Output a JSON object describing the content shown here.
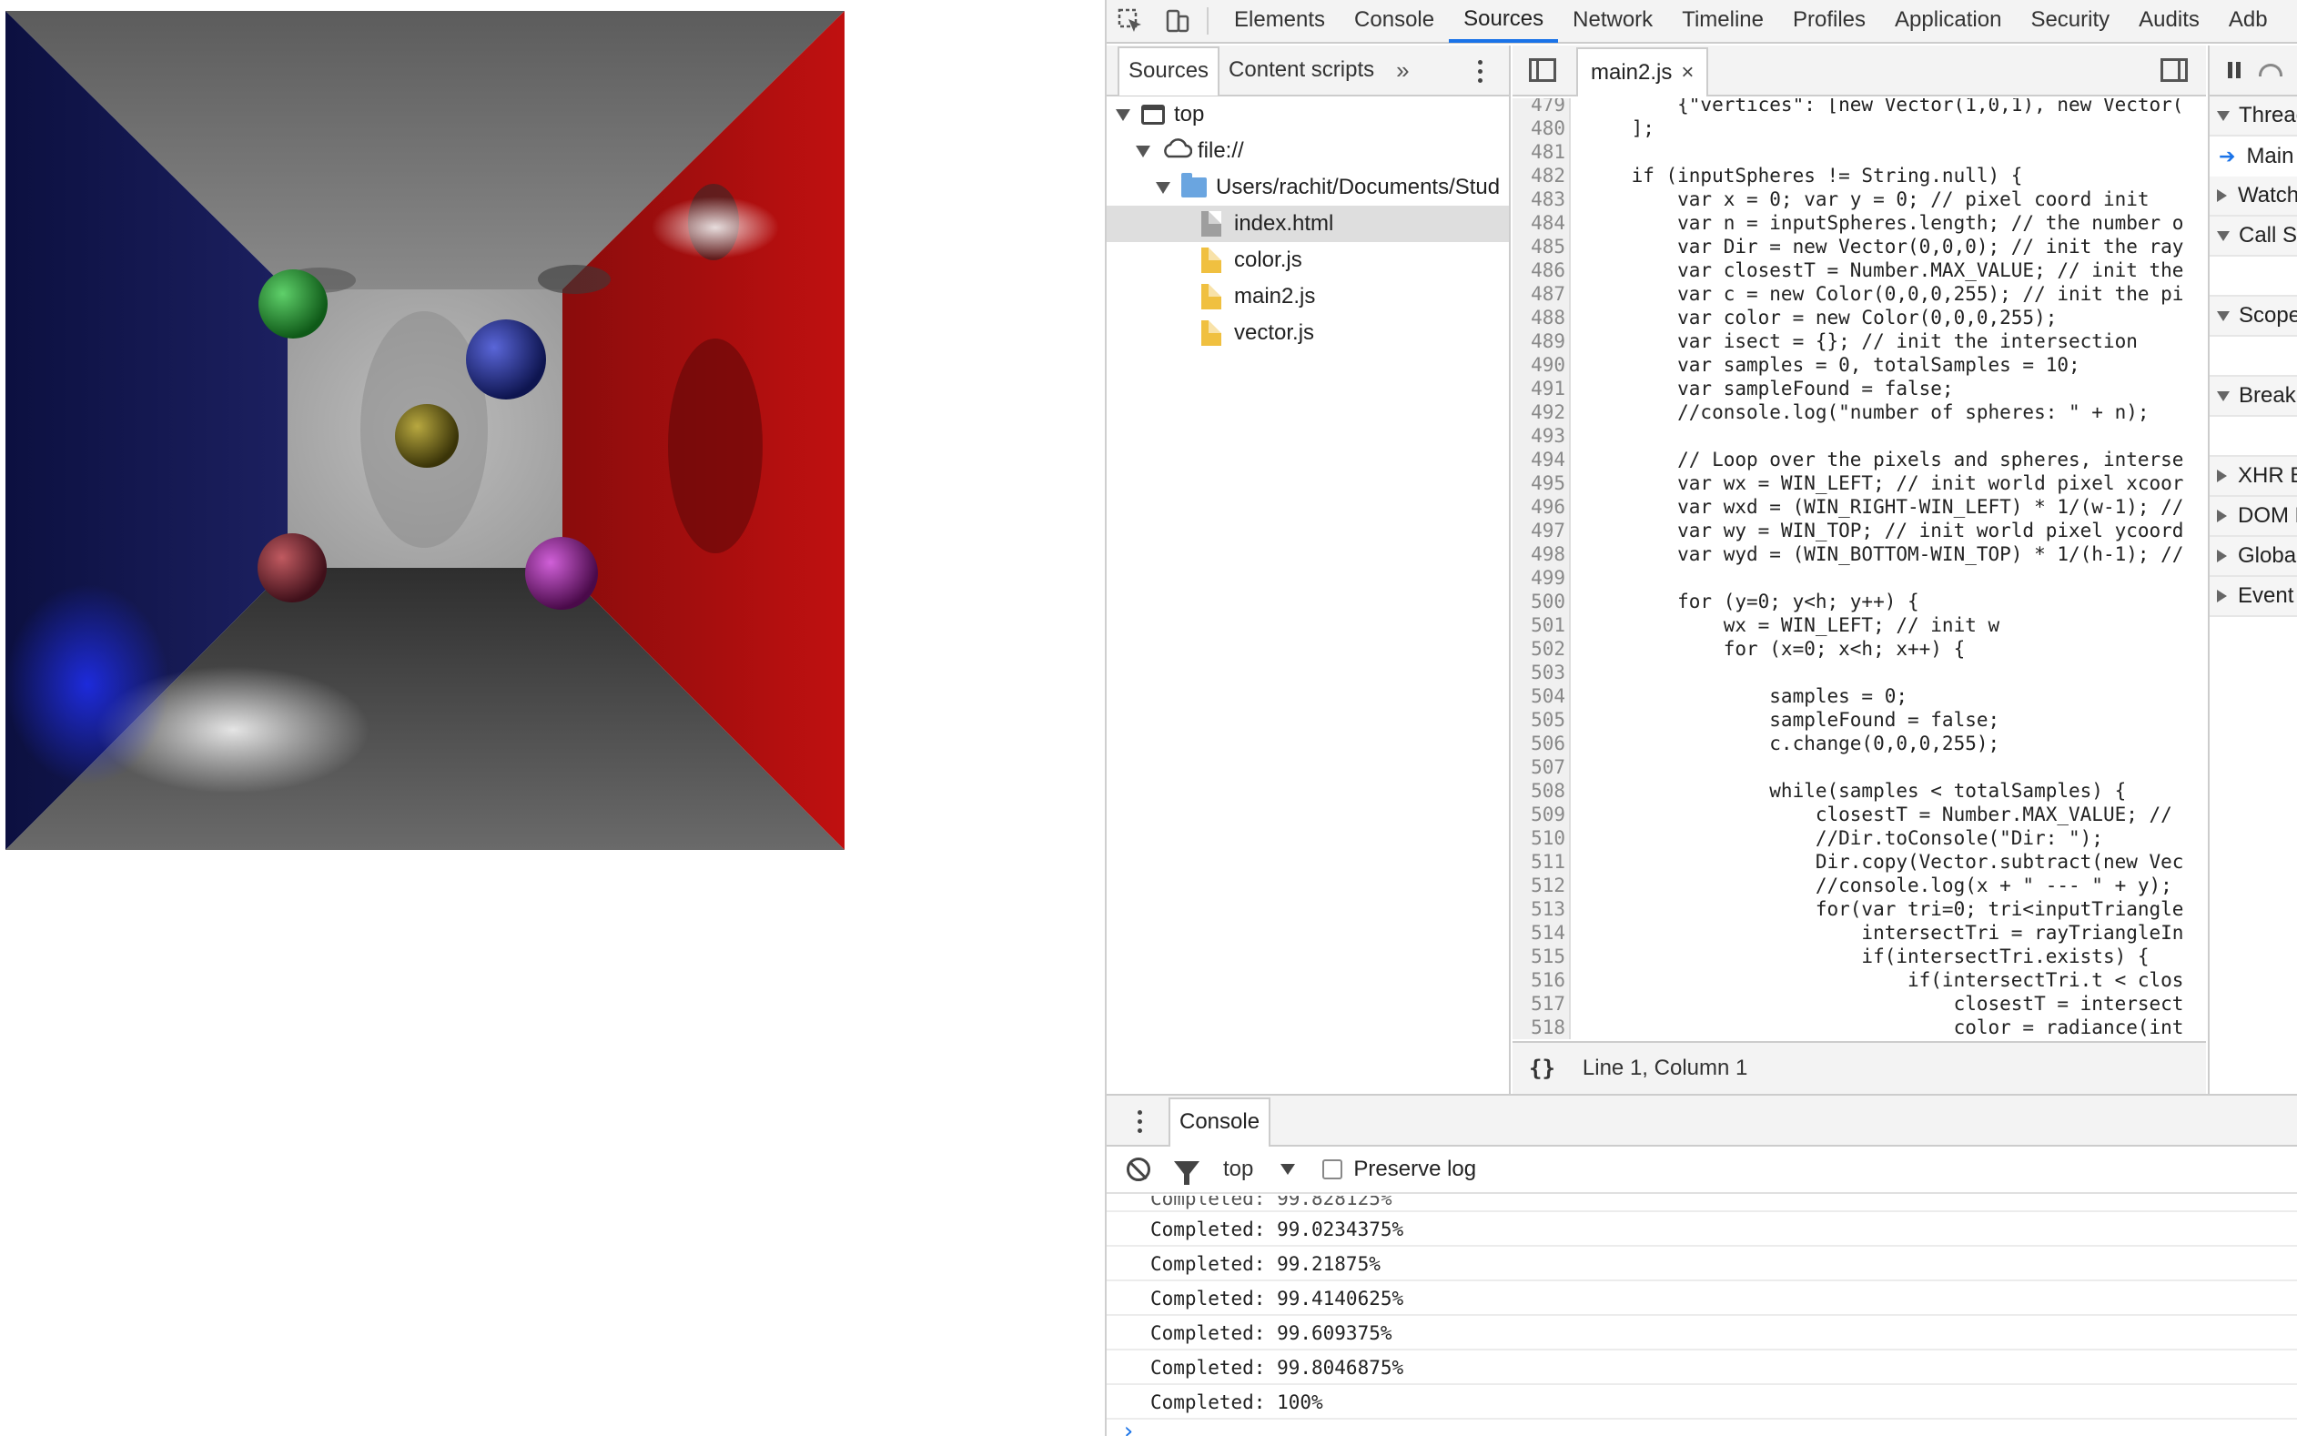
{
  "devtools": {
    "main_tabs": [
      {
        "label": "Elements",
        "active": false
      },
      {
        "label": "Console",
        "active": false
      },
      {
        "label": "Sources",
        "active": true
      },
      {
        "label": "Network",
        "active": false
      },
      {
        "label": "Timeline",
        "active": false
      },
      {
        "label": "Profiles",
        "active": false
      },
      {
        "label": "Application",
        "active": false
      },
      {
        "label": "Security",
        "active": false
      },
      {
        "label": "Audits",
        "active": false
      },
      {
        "label": "Adb",
        "active": false
      }
    ],
    "accent_color": "#1a73e8"
  },
  "navigator": {
    "tabs": [
      {
        "label": "Sources",
        "active": true
      },
      {
        "label": "Content scripts",
        "active": false
      }
    ],
    "more_label": "»",
    "tree": [
      {
        "label": "top",
        "icon": "frame-icon",
        "type": "frame",
        "indent": 0,
        "expanded": true,
        "selected": false
      },
      {
        "label": "file://",
        "icon": "cloud-icon",
        "type": "origin",
        "indent": 1,
        "expanded": true,
        "selected": false
      },
      {
        "label": "Users/rachit/Documents/Stud",
        "icon": "folder-icon",
        "type": "folder",
        "indent": 2,
        "expanded": true,
        "selected": false
      },
      {
        "label": "index.html",
        "icon": "html-file-icon",
        "type": "file-gray",
        "indent": 3,
        "expanded": false,
        "selected": true
      },
      {
        "label": "color.js",
        "icon": "js-file-icon",
        "type": "file-yellow",
        "indent": 3,
        "expanded": false,
        "selected": false
      },
      {
        "label": "main2.js",
        "icon": "js-file-icon",
        "type": "file-yellow",
        "indent": 3,
        "expanded": false,
        "selected": false
      },
      {
        "label": "vector.js",
        "icon": "js-file-icon",
        "type": "file-yellow",
        "indent": 3,
        "expanded": false,
        "selected": false
      }
    ]
  },
  "editor": {
    "open_file": "main2.js",
    "close_glyph": "×",
    "status_braces": "{}",
    "status_text": "Line 1, Column 1",
    "lines": [
      {
        "n": "479",
        "code": "        {\"vertices\": [new Vector(1,0,1), new Vector("
      },
      {
        "n": "480",
        "code": "    ];"
      },
      {
        "n": "481",
        "code": ""
      },
      {
        "n": "482",
        "code": "    if (inputSpheres != String.null) {"
      },
      {
        "n": "483",
        "code": "        var x = 0; var y = 0; // pixel coord init"
      },
      {
        "n": "484",
        "code": "        var n = inputSpheres.length; // the number o"
      },
      {
        "n": "485",
        "code": "        var Dir = new Vector(0,0,0); // init the ray"
      },
      {
        "n": "486",
        "code": "        var closestT = Number.MAX_VALUE; // init the"
      },
      {
        "n": "487",
        "code": "        var c = new Color(0,0,0,255); // init the pi"
      },
      {
        "n": "488",
        "code": "        var color = new Color(0,0,0,255);"
      },
      {
        "n": "489",
        "code": "        var isect = {}; // init the intersection"
      },
      {
        "n": "490",
        "code": "        var samples = 0, totalSamples = 10;"
      },
      {
        "n": "491",
        "code": "        var sampleFound = false;"
      },
      {
        "n": "492",
        "code": "        //console.log(\"number of spheres: \" + n);"
      },
      {
        "n": "493",
        "code": ""
      },
      {
        "n": "494",
        "code": "        // Loop over the pixels and spheres, interse"
      },
      {
        "n": "495",
        "code": "        var wx = WIN_LEFT; // init world pixel xcoor"
      },
      {
        "n": "496",
        "code": "        var wxd = (WIN_RIGHT-WIN_LEFT) * 1/(w-1); //"
      },
      {
        "n": "497",
        "code": "        var wy = WIN_TOP; // init world pixel ycoord"
      },
      {
        "n": "498",
        "code": "        var wyd = (WIN_BOTTOM-WIN_TOP) * 1/(h-1); //"
      },
      {
        "n": "499",
        "code": ""
      },
      {
        "n": "500",
        "code": "        for (y=0; y<h; y++) {"
      },
      {
        "n": "501",
        "code": "            wx = WIN_LEFT; // init w"
      },
      {
        "n": "502",
        "code": "            for (x=0; x<h; x++) {"
      },
      {
        "n": "503",
        "code": ""
      },
      {
        "n": "504",
        "code": "                samples = 0;"
      },
      {
        "n": "505",
        "code": "                sampleFound = false;"
      },
      {
        "n": "506",
        "code": "                c.change(0,0,0,255);"
      },
      {
        "n": "507",
        "code": ""
      },
      {
        "n": "508",
        "code": "                while(samples < totalSamples) {"
      },
      {
        "n": "509",
        "code": "                    closestT = Number.MAX_VALUE; //"
      },
      {
        "n": "510",
        "code": "                    //Dir.toConsole(\"Dir: \");"
      },
      {
        "n": "511",
        "code": "                    Dir.copy(Vector.subtract(new Vec"
      },
      {
        "n": "512",
        "code": "                    //console.log(x + \" --- \" + y);"
      },
      {
        "n": "513",
        "code": "                    for(var tri=0; tri<inputTriangle"
      },
      {
        "n": "514",
        "code": "                        intersectTri = rayTriangleIn"
      },
      {
        "n": "515",
        "code": "                        if(intersectTri.exists) {"
      },
      {
        "n": "516",
        "code": "                            if(intersectTri.t < clos"
      },
      {
        "n": "517",
        "code": "                                closestT = intersect"
      },
      {
        "n": "518",
        "code": "                                color = radiance(int"
      }
    ]
  },
  "debugger": {
    "panes": [
      {
        "label": "Threads",
        "expanded": true
      },
      {
        "label": "Watch",
        "expanded": false
      },
      {
        "label": "Call Stack",
        "expanded": true
      },
      {
        "label": "Scope",
        "expanded": true
      },
      {
        "label": "Breakpoints",
        "expanded": true
      },
      {
        "label": "XHR Breakpoints",
        "expanded": false
      },
      {
        "label": "DOM Breakpoints",
        "expanded": false
      },
      {
        "label": "Global Listeners",
        "expanded": false
      },
      {
        "label": "Event Listener Breakpoints",
        "expanded": false
      }
    ],
    "thread_main": "Main"
  },
  "console": {
    "tab_label": "Console",
    "context": "top",
    "preserve_log_label": "Preserve log",
    "preserve_log_checked": false,
    "partial_line": "Completed: 99.828125%",
    "messages": [
      "Completed: 99.0234375%",
      "Completed: 99.21875%",
      "Completed: 99.4140625%",
      "Completed: 99.609375%",
      "Completed: 99.8046875%",
      "Completed: 100%"
    ],
    "prompt": "›"
  },
  "render_colors": {
    "left_wall": "#141850",
    "right_wall": "#b01010",
    "sphere_green": "#1f8a2c",
    "sphere_blue": "#1e2a8c",
    "sphere_yellow": "#7a6e18",
    "sphere_red": "#7a2028",
    "sphere_magenta": "#8a1a8a"
  }
}
